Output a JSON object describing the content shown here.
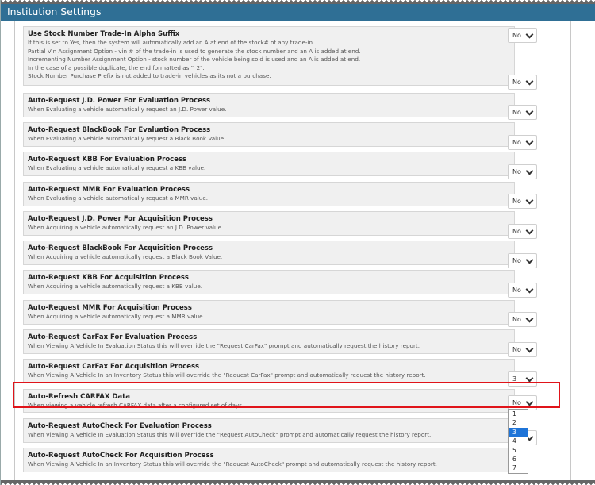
{
  "header": {
    "title": "Institution Settings"
  },
  "settings": [
    {
      "title": "Use Stock Number Trade-In Alpha Suffix",
      "lines": [
        "If this is set to Yes, then the system will automatically add an A at end of the stock# of any trade-in.",
        "Partial Vin Assignment Option - vin # of the trade-in is used to generate the stock number and an A is added at end.",
        "Incrementing Number Assignment Option - stock number of the vehicle being sold is used and an A is added at end.",
        "In the case of a possible duplicate, the end formatted as \"_2\".",
        "Stock Number Purchase Prefix is not added to trade-in vehicles as its not a purchase."
      ],
      "value": "No"
    },
    {
      "title": "Auto-Request J.D. Power For Evaluation Process",
      "lines": [
        "When Evaluating a vehicle automatically request an J.D. Power value."
      ],
      "value": "No"
    },
    {
      "title": "Auto-Request BlackBook For Evaluation Process",
      "lines": [
        "When Evaluating a vehicle automatically request a Black Book Value."
      ],
      "value": "No"
    },
    {
      "title": "Auto-Request KBB For Evaluation Process",
      "lines": [
        "When Evaluating a vehicle automatically request a KBB value."
      ],
      "value": "No"
    },
    {
      "title": "Auto-Request MMR For Evaluation Process",
      "lines": [
        "When Evaluating a vehicle automatically request a MMR value."
      ],
      "value": "No"
    },
    {
      "title": "Auto-Request J.D. Power For Acquisition Process",
      "lines": [
        "When Acquiring a vehicle automatically request an J.D. Power value."
      ],
      "value": "No"
    },
    {
      "title": "Auto-Request BlackBook For Acquisition Process",
      "lines": [
        "When Acquiring a vehicle automatically request a Black Book Value."
      ],
      "value": "No"
    },
    {
      "title": "Auto-Request KBB For Acquisition Process",
      "lines": [
        "When Acquiring a vehicle automatically request a KBB value."
      ],
      "value": "No"
    },
    {
      "title": "Auto-Request MMR For Acquisition Process",
      "lines": [
        "When Acquiring a vehicle automatically request a MMR value."
      ],
      "value": "No"
    },
    {
      "title": "Auto-Request CarFax For Evaluation Process",
      "lines": [
        "When Viewing A Vehicle In Evaluation Status this will override the \"Request CarFax\" prompt and automatically request the history report."
      ],
      "value": "No"
    },
    {
      "title": "Auto-Request CarFax For Acquisition Process",
      "lines": [
        "When Viewing A Vehicle In an Inventory Status this will override the \"Request CarFax\" prompt and automatically request the history report."
      ],
      "value": "No"
    },
    {
      "title": "Auto-Refresh CARFAX Data",
      "lines": [
        "When viewing a vehicle refresh CARFAX data after a configured set of days."
      ],
      "value": "3"
    },
    {
      "title": "Auto-Request AutoCheck For Evaluation Process",
      "lines": [
        "When Viewing A Vehicle In Evaluation Status this will override the \"Request AutoCheck\" prompt and automatically request the history report."
      ],
      "value": "No"
    },
    {
      "title": "Auto-Request AutoCheck For Acquisition Process",
      "lines": [
        "When Viewing A Vehicle In an Inventory Status this will override the \"Request AutoCheck\" prompt and automatically request the history report."
      ],
      "value": "No"
    }
  ],
  "dropdown": {
    "options": [
      "1",
      "2",
      "3",
      "4",
      "5",
      "6",
      "7"
    ],
    "selected": "3"
  },
  "colors": {
    "header_bg": "#2f6f95",
    "highlight": "#e0141a",
    "selected_option": "#1e74d8"
  }
}
